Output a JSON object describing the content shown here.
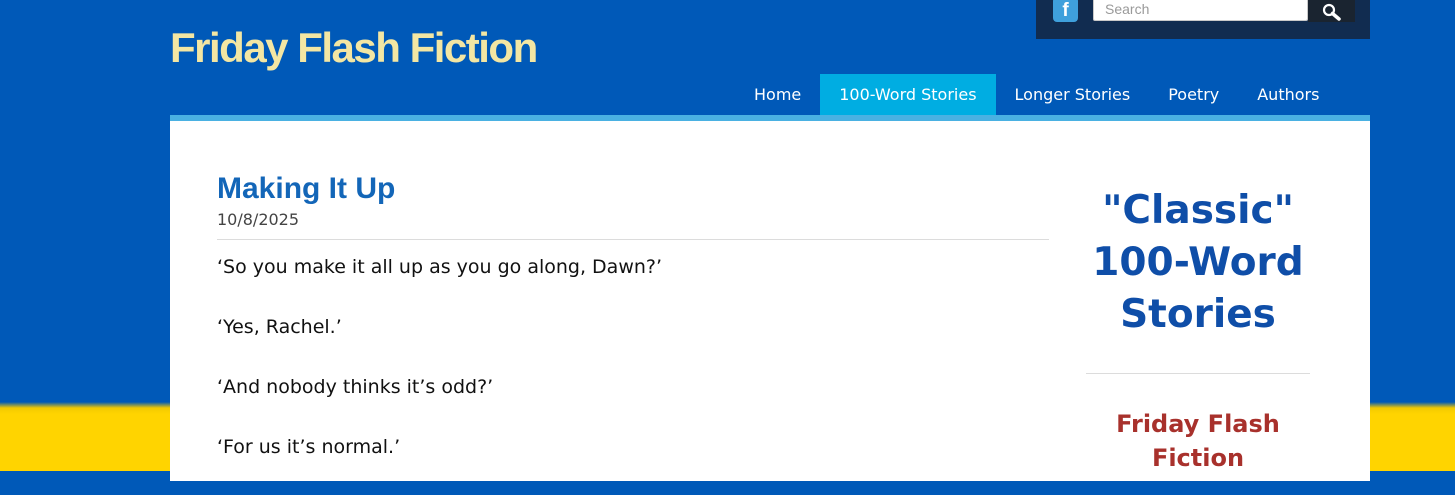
{
  "site": {
    "title": "Friday Flash Fiction"
  },
  "topbar": {
    "social_icon": "facebook-icon",
    "social_glyph": "f",
    "search_placeholder": "Search",
    "search_button_icon": "search-icon"
  },
  "nav": {
    "items": [
      {
        "label": "Home",
        "active": false
      },
      {
        "label": "100-Word Stories",
        "active": true
      },
      {
        "label": "Longer Stories",
        "active": false
      },
      {
        "label": "Poetry",
        "active": false
      },
      {
        "label": "Authors",
        "active": false
      }
    ]
  },
  "post": {
    "title": "Making It Up",
    "date": "10/8/2025",
    "paragraphs": [
      "‘So you make it all up as you go along, Dawn?’",
      "‘Yes, Rachel.’",
      "‘And nobody thinks it’s odd?’",
      "‘For us it’s normal.’"
    ]
  },
  "sidebar": {
    "heading": "\"Classic\" 100-Word Stories",
    "subheading": "Friday Flash Fiction"
  },
  "colors": {
    "background_blue": "#0059b8",
    "background_yellow": "#ffd400",
    "title_cream": "#f3e6a3",
    "nav_active": "#00ade2",
    "post_title_blue": "#1366b8",
    "sidebar_heading_blue": "#0f4ea8",
    "sidebar_sub_red": "#a8312c"
  }
}
